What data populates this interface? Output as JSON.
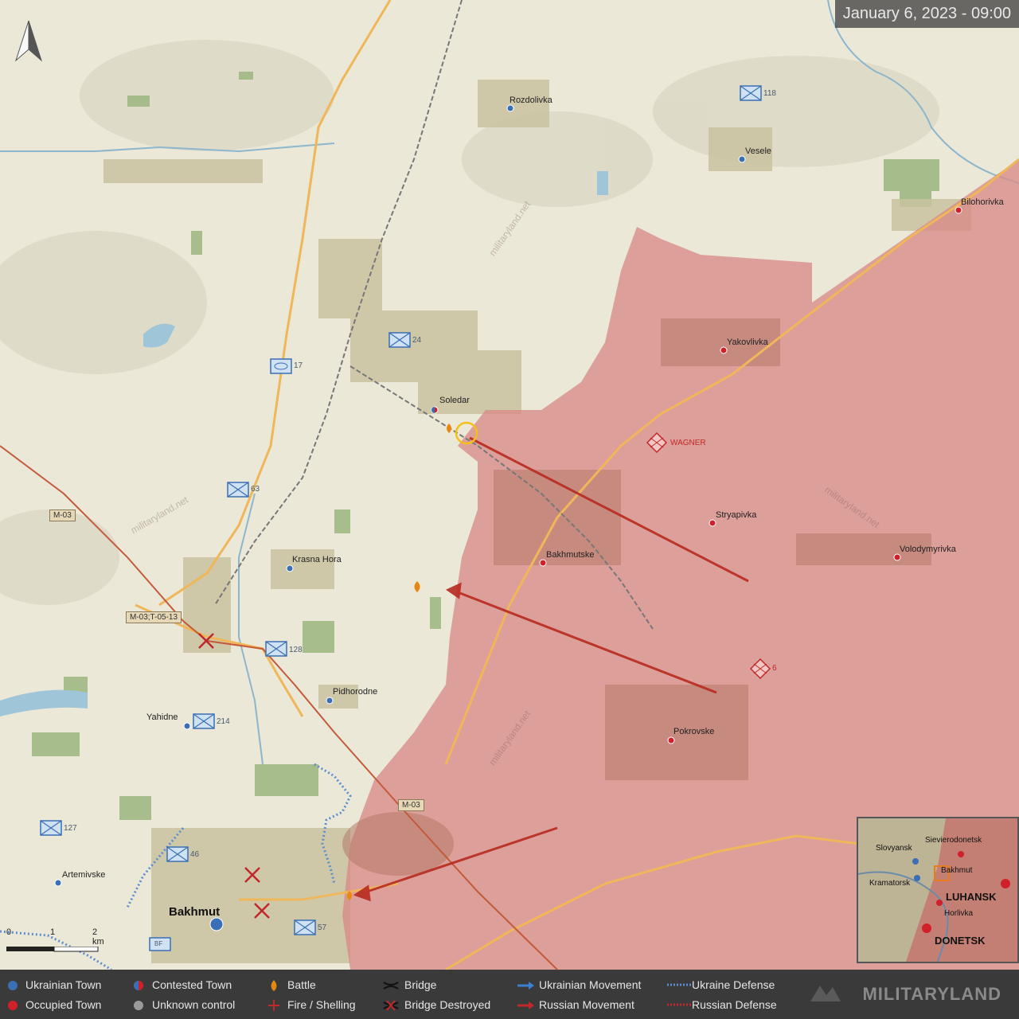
{
  "header": {
    "date": "January 6, 2023 - 09:00"
  },
  "towns": {
    "rozdolivka": "Rozdolivka",
    "vesele": "Vesele",
    "bilohorivka": "Bilohorivka",
    "yakovlivka": "Yakovlivka",
    "soledar": "Soledar",
    "stryapivka": "Stryapivka",
    "volodymyrivka": "Volodymyrivka",
    "bakhmutske": "Bakhmutske",
    "krasna_hora": "Krasna Hora",
    "pidhorodne": "Pidhorodne",
    "yahidne": "Yahidne",
    "pokrovske": "Pokrovske",
    "artemivske": "Artemivske",
    "bakhmut": "Bakhmut"
  },
  "units": {
    "u118": "118",
    "u24": "24",
    "u17": "17",
    "u63": "63",
    "u128": "128",
    "u214": "214",
    "u127": "127",
    "u46": "46",
    "u57": "57",
    "wagner": "WAGNER",
    "u6": "6",
    "bf": "BF"
  },
  "roads": {
    "m03_a": "M-03",
    "m03_t": "M-03;T-05-13",
    "m03_b": "M-03"
  },
  "scale": {
    "s0": "0",
    "s1": "1",
    "s2": "2 km"
  },
  "inset": {
    "slovyansk": "Slovyansk",
    "sievierodonetsk": "Sievierodonetsk",
    "kramatorsk": "Kramatorsk",
    "bakhmut": "Bakhmut",
    "luhansk": "LUHANSK",
    "horlivka": "Horlivka",
    "donetsk": "DONETSK"
  },
  "watermark": "militaryland.net",
  "legend": {
    "ukrainian_town": "Ukrainian Town",
    "occupied_town": "Occupied Town",
    "contested_town": "Contested Town",
    "unknown_control": "Unknown control",
    "battle": "Battle",
    "fire_shelling": "Fire / Shelling",
    "bridge": "Bridge",
    "bridge_destroyed": "Bridge Destroyed",
    "ukrainian_movement": "Ukrainian Movement",
    "russian_movement": "Russian Movement",
    "ukraine_defense": "Ukraine Defense",
    "russian_defense": "Russian Defense"
  },
  "brand": "MILITARYLAND",
  "colors": {
    "occupied": "#d98b86",
    "ukrainian_town": "#3a6fb5",
    "occupied_town": "#d0202a",
    "battle": "#e8870f",
    "movement_ru": "#b82a20"
  }
}
